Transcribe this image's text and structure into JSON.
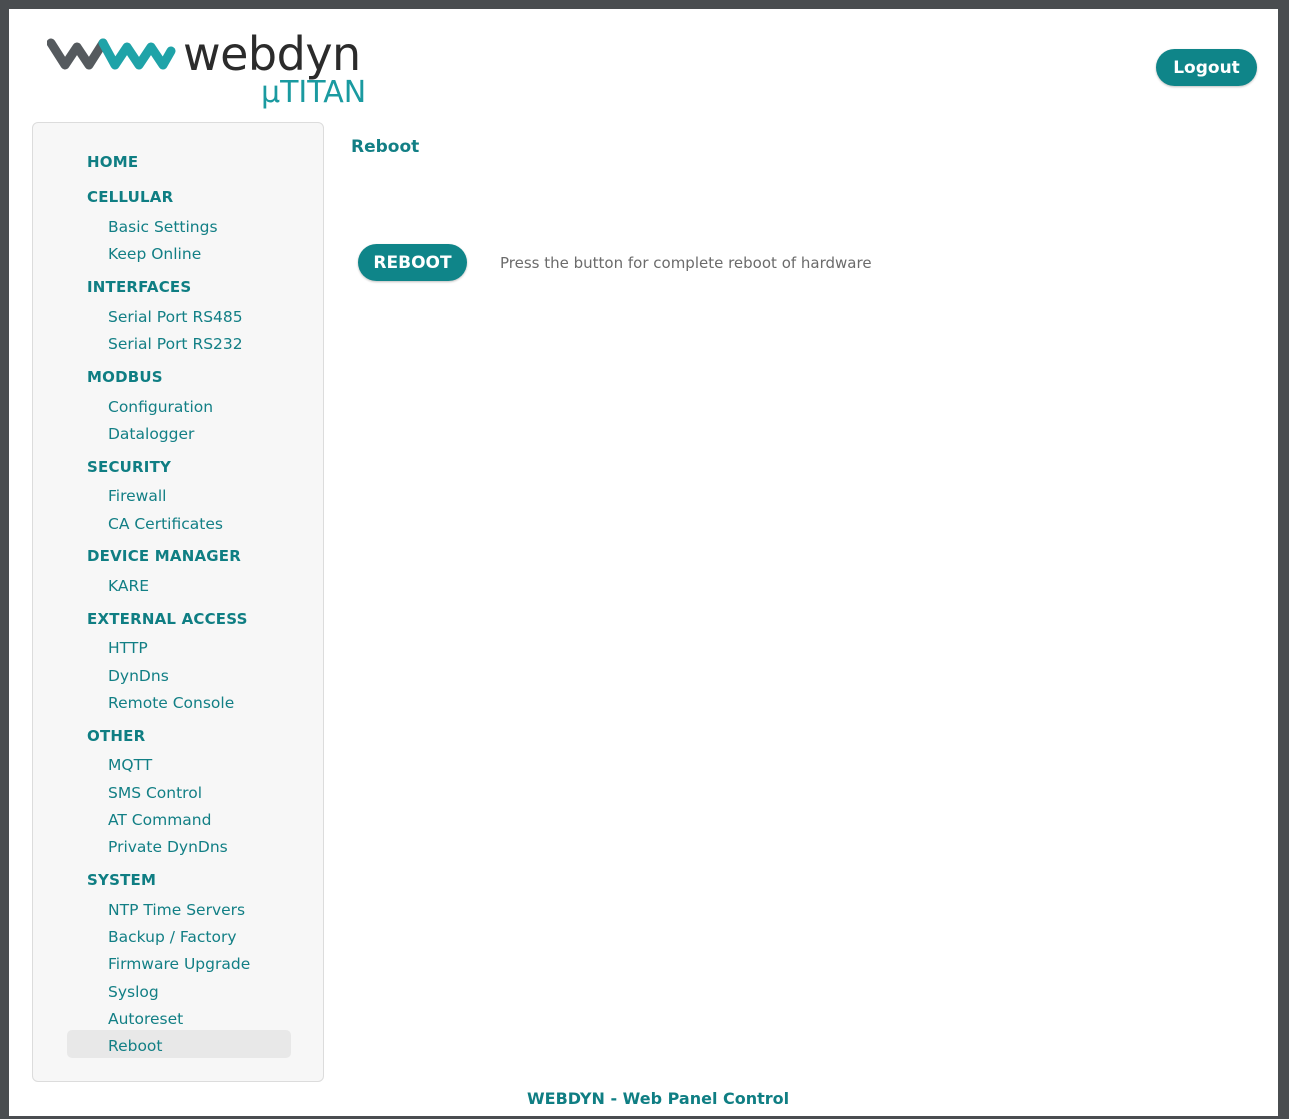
{
  "brand": {
    "wordmark": "webdyn",
    "product": "µTITAN",
    "primary_color": "#0f8589",
    "accent_color": "#1a9aa0"
  },
  "header": {
    "logout_label": "Logout"
  },
  "sidebar": {
    "active_item": "Reboot",
    "sections": [
      {
        "label": "HOME",
        "items": []
      },
      {
        "label": "CELLULAR",
        "items": [
          "Basic Settings",
          "Keep Online"
        ]
      },
      {
        "label": "INTERFACES",
        "items": [
          "Serial Port RS485",
          "Serial Port RS232"
        ]
      },
      {
        "label": "MODBUS",
        "items": [
          "Configuration",
          "Datalogger"
        ]
      },
      {
        "label": "SECURITY",
        "items": [
          "Firewall",
          "CA Certificates"
        ]
      },
      {
        "label": "DEVICE MANAGER",
        "items": [
          "KARE"
        ]
      },
      {
        "label": "EXTERNAL ACCESS",
        "items": [
          "HTTP",
          "DynDns",
          "Remote Console"
        ]
      },
      {
        "label": "OTHER",
        "items": [
          "MQTT",
          "SMS Control",
          "AT Command",
          "Private DynDns"
        ]
      },
      {
        "label": "SYSTEM",
        "items": [
          "NTP Time Servers",
          "Backup / Factory",
          "Firmware Upgrade",
          "Syslog",
          "Autoreset",
          "Reboot"
        ]
      }
    ]
  },
  "main": {
    "title": "Reboot",
    "reboot_button_label": "REBOOT",
    "reboot_description": "Press the button for complete reboot of hardware"
  },
  "footer": {
    "brand": "WEBDYN",
    "separator": "-",
    "text": "Web Panel Control"
  }
}
